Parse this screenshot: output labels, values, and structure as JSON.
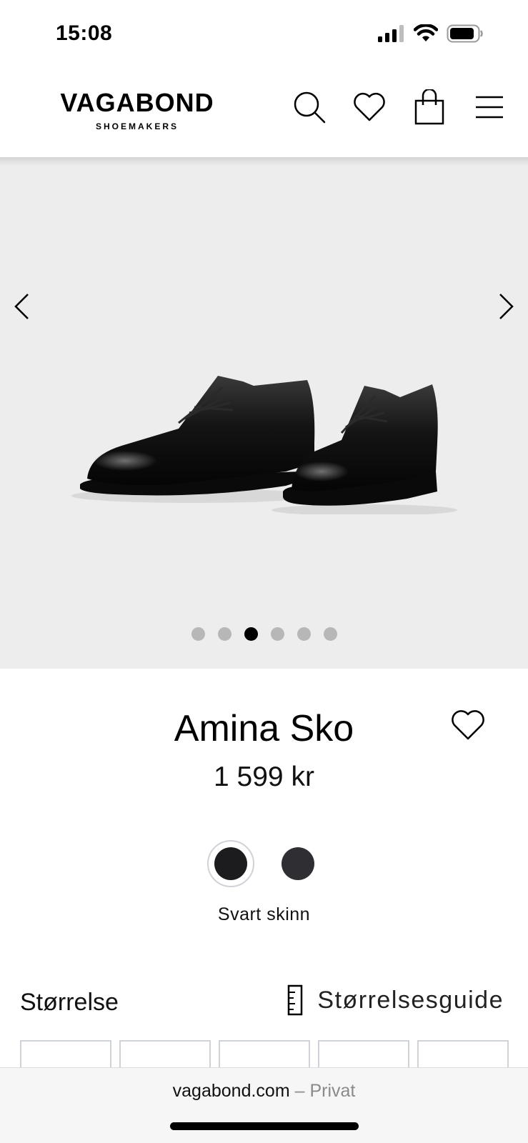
{
  "status_bar": {
    "time": "15:08"
  },
  "header": {
    "logo_main": "VAGABOND",
    "logo_sub": "SHOEMAKERS",
    "icons": [
      "search-icon",
      "heart-icon",
      "shopping-bag-icon",
      "menu-icon"
    ]
  },
  "gallery": {
    "dot_count": 6,
    "active_index": 2,
    "background": "#ededed"
  },
  "product": {
    "name": "Amina Sko",
    "price": "1 599 kr",
    "colors": [
      {
        "name": "Svart skinn",
        "hex": "#1c1c1e",
        "selected": true
      },
      {
        "hex": "#2e2e33",
        "selected": false
      }
    ],
    "selected_color_label": "Svart skinn"
  },
  "size_section": {
    "label": "Størrelse",
    "guide_label": "Størrelsesguide"
  },
  "browser": {
    "url_host": "vagabond.com",
    "url_suffix": " – Privat"
  }
}
